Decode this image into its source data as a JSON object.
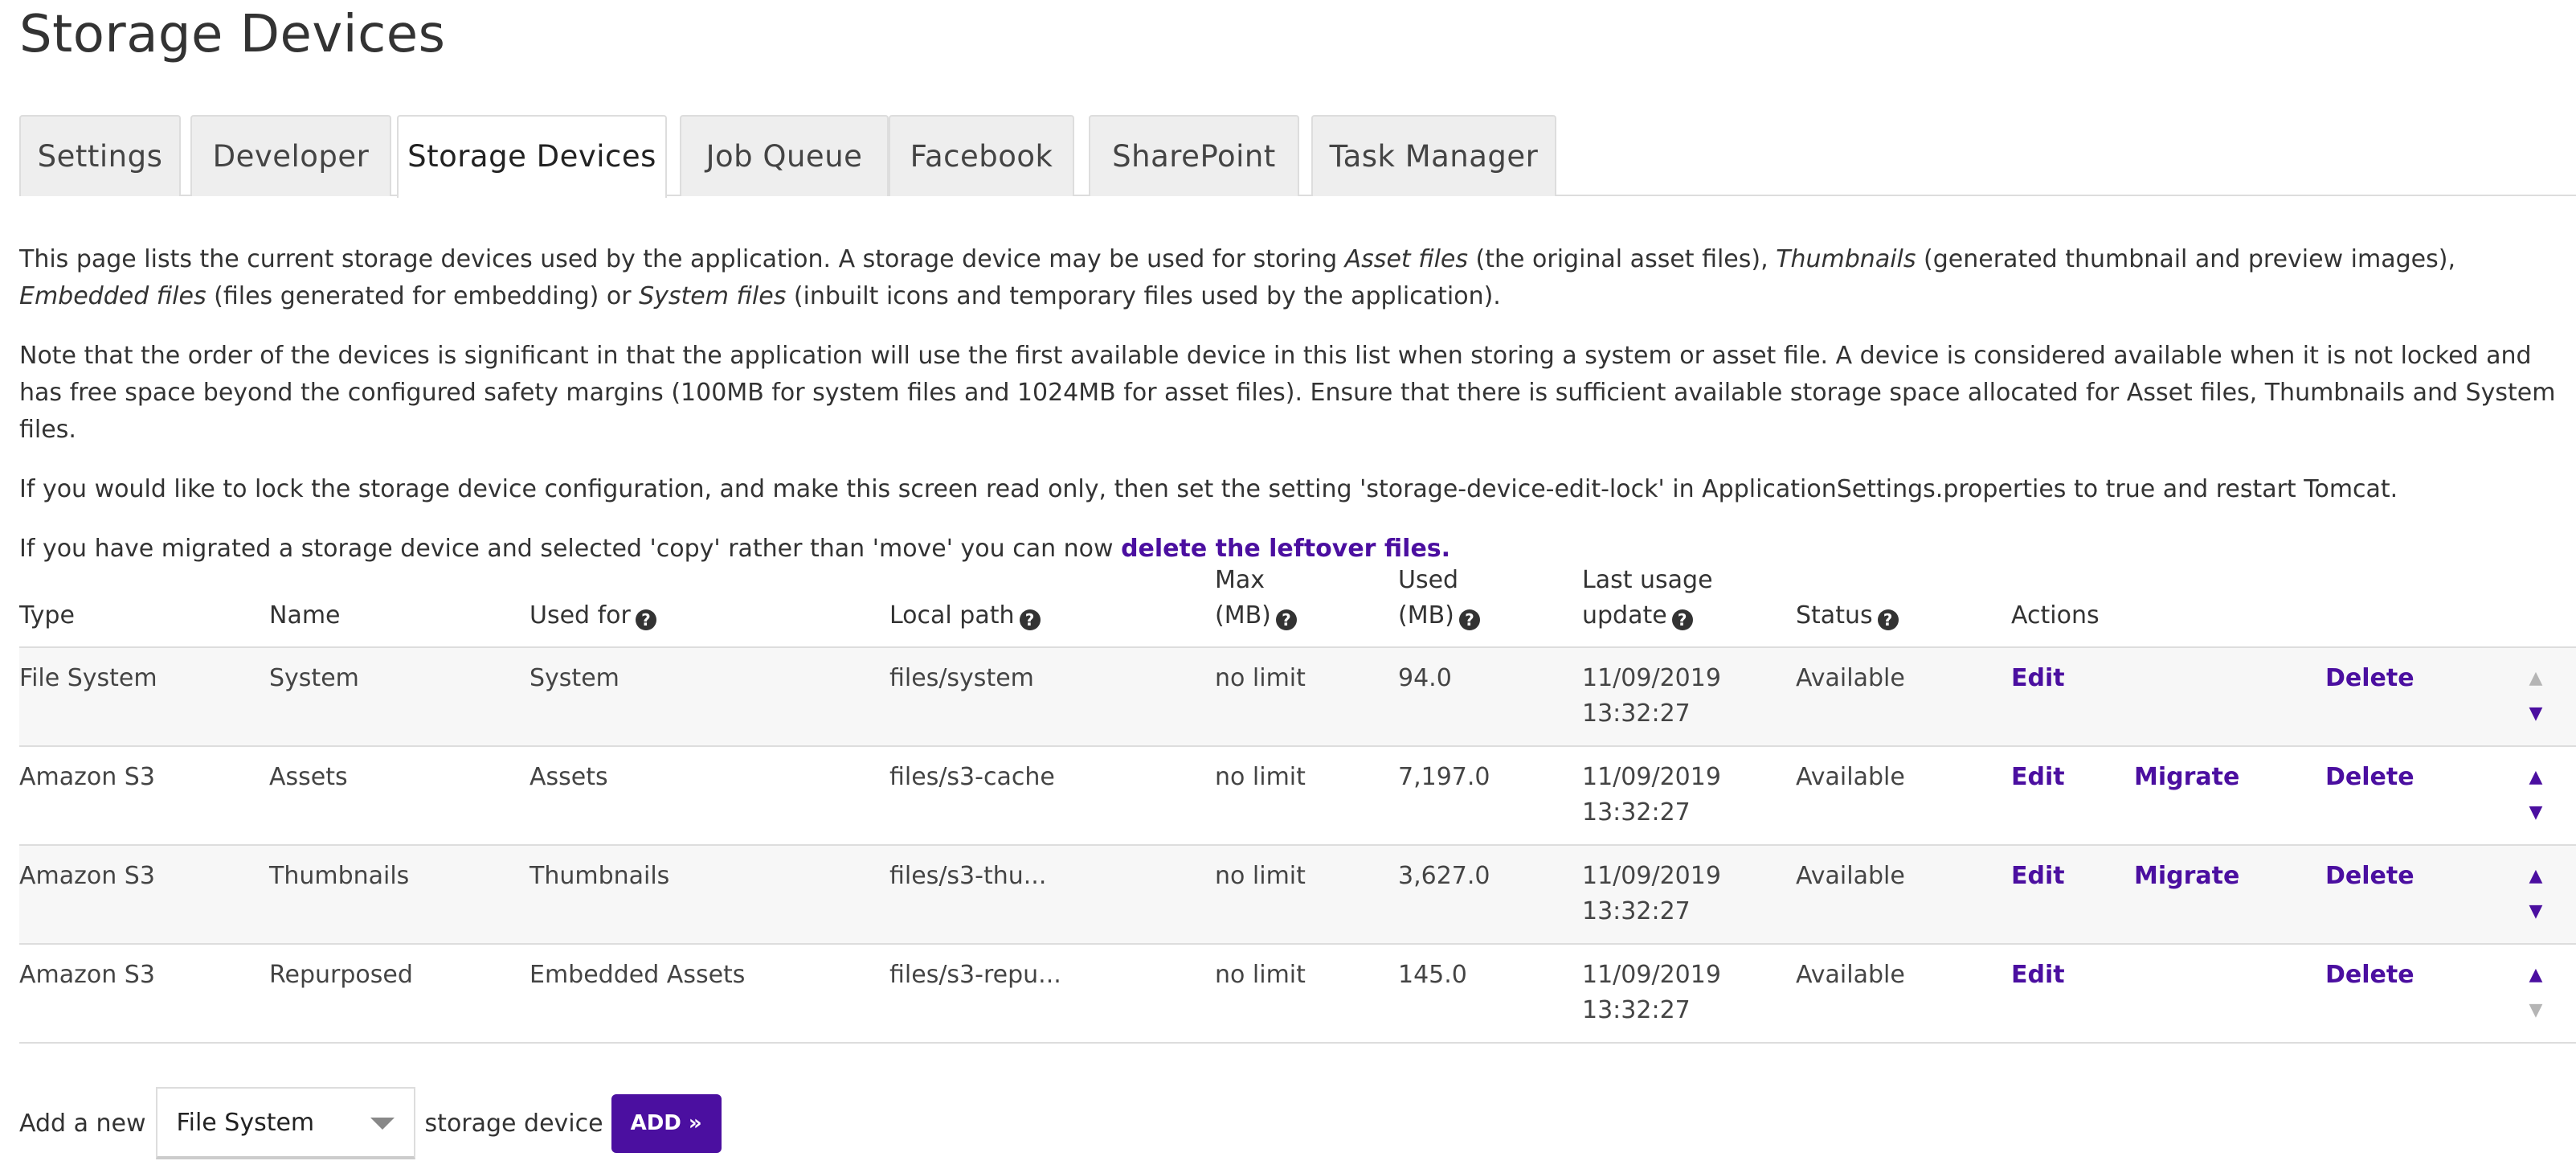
{
  "page_title": "Storage Devices",
  "tabs": [
    {
      "label": "Settings",
      "active": false
    },
    {
      "label": "Developer",
      "active": false
    },
    {
      "label": "Storage Devices",
      "active": true
    },
    {
      "label": "Job Queue",
      "active": false
    },
    {
      "label": "Facebook",
      "active": false
    },
    {
      "label": "SharePoint",
      "active": false
    },
    {
      "label": "Task Manager",
      "active": false
    }
  ],
  "intro": {
    "p1": {
      "a": "This page lists the current storage devices used by the application. A storage device may be used for storing ",
      "asset_files": "Asset files",
      "b": " (the original asset files), ",
      "thumbnails": "Thumbnails",
      "c": " (generated thumbnail and preview images), ",
      "embedded_files": "Embedded files",
      "d": " (files generated for embedding) or ",
      "system_files": "System files",
      "e": " (inbuilt icons and temporary files used by the application)."
    },
    "p2": "Note that the order of the devices is significant in that the application will use the first available device in this list when storing a system or asset file. A device is considered available when it is not locked and has free space beyond the configured safety margins (100MB for system files and 1024MB for asset files). Ensure that there is sufficient available storage space allocated for Asset files, Thumbnails and System files.",
    "p3": "If you would like to lock the storage device configuration, and make this screen read only, then set the setting 'storage-device-edit-lock' in ApplicationSettings.properties to true and restart Tomcat.",
    "p4_text": "If you have migrated a storage device and selected 'copy' rather than 'move' you can now ",
    "p4_link": "delete the leftover files."
  },
  "table": {
    "headers": {
      "type": "Type",
      "name": "Name",
      "used_for": "Used for",
      "local_path": "Local path",
      "max_mb_1": "Max",
      "max_mb_2": "(MB)",
      "used_mb_1": "Used",
      "used_mb_2": "(MB)",
      "last_usage_1": "Last usage",
      "last_usage_2": "update",
      "status": "Status",
      "actions": "Actions"
    },
    "rows": [
      {
        "type": "File System",
        "name": "System",
        "used_for": "System",
        "local_path": "files/system",
        "max": "no limit",
        "used": "94.0",
        "date": "11/09/2019",
        "time": "13:32:27",
        "status": "Available",
        "edit": "Edit",
        "migrate": "",
        "delete": "Delete",
        "up_enabled": false,
        "down_enabled": true
      },
      {
        "type": "Amazon S3",
        "name": "Assets",
        "used_for": "Assets",
        "local_path": "files/s3-cache",
        "max": "no limit",
        "used": "7,197.0",
        "date": "11/09/2019",
        "time": "13:32:27",
        "status": "Available",
        "edit": "Edit",
        "migrate": "Migrate",
        "delete": "Delete",
        "up_enabled": true,
        "down_enabled": true
      },
      {
        "type": "Amazon S3",
        "name": "Thumbnails",
        "used_for": "Thumbnails",
        "local_path": "files/s3-thu...",
        "max": "no limit",
        "used": "3,627.0",
        "date": "11/09/2019",
        "time": "13:32:27",
        "status": "Available",
        "edit": "Edit",
        "migrate": "Migrate",
        "delete": "Delete",
        "up_enabled": true,
        "down_enabled": true
      },
      {
        "type": "Amazon S3",
        "name": "Repurposed",
        "used_for": "Embedded Assets",
        "local_path": "files/s3-repu...",
        "max": "no limit",
        "used": "145.0",
        "date": "11/09/2019",
        "time": "13:32:27",
        "status": "Available",
        "edit": "Edit",
        "migrate": "",
        "delete": "Delete",
        "up_enabled": true,
        "down_enabled": false
      }
    ]
  },
  "add_device": {
    "prefix": "Add a new",
    "selected": "File System",
    "suffix": "storage device",
    "button": "ADD »"
  },
  "icons": {
    "help": "question-circle-icon",
    "move_up": "triangle-up-icon",
    "move_down": "triangle-down-icon",
    "select_caret": "chevron-down-icon"
  },
  "colors": {
    "link": "#4b0fa0",
    "status_available": "#2e8b22",
    "muted": "#aaaaaa",
    "button_bg": "#4b0fa0"
  }
}
